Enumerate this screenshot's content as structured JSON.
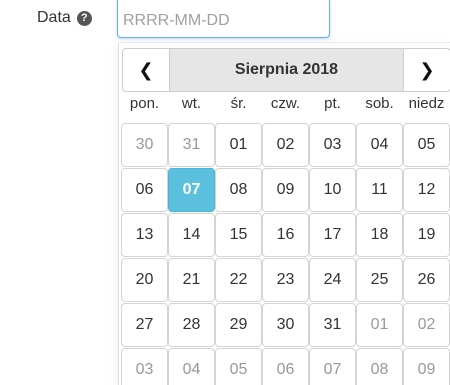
{
  "field": {
    "label": "Data",
    "help_icon": "question-circle-icon",
    "placeholder": "RRRR-MM-DD",
    "value": ""
  },
  "picker": {
    "month_title": "Sierpnia 2018",
    "prev_icon": "chevron-left-icon",
    "next_icon": "chevron-right-icon",
    "prev_glyph": "❮",
    "next_glyph": "❯",
    "weekdays": [
      "pon.",
      "wt.",
      "śr.",
      "czw.",
      "pt.",
      "sob.",
      "niedz"
    ],
    "weeks": [
      [
        {
          "d": "30",
          "m": true
        },
        {
          "d": "31",
          "m": true
        },
        {
          "d": "01"
        },
        {
          "d": "02"
        },
        {
          "d": "03"
        },
        {
          "d": "04"
        },
        {
          "d": "05"
        }
      ],
      [
        {
          "d": "06"
        },
        {
          "d": "07",
          "active": true
        },
        {
          "d": "08"
        },
        {
          "d": "09"
        },
        {
          "d": "10"
        },
        {
          "d": "11"
        },
        {
          "d": "12"
        }
      ],
      [
        {
          "d": "13"
        },
        {
          "d": "14"
        },
        {
          "d": "15"
        },
        {
          "d": "16"
        },
        {
          "d": "17"
        },
        {
          "d": "18"
        },
        {
          "d": "19"
        }
      ],
      [
        {
          "d": "20"
        },
        {
          "d": "21"
        },
        {
          "d": "22"
        },
        {
          "d": "23"
        },
        {
          "d": "24"
        },
        {
          "d": "25"
        },
        {
          "d": "26"
        }
      ],
      [
        {
          "d": "27"
        },
        {
          "d": "28"
        },
        {
          "d": "29"
        },
        {
          "d": "30"
        },
        {
          "d": "31"
        },
        {
          "d": "01",
          "m": true
        },
        {
          "d": "02",
          "m": true
        }
      ],
      [
        {
          "d": "03",
          "m": true
        },
        {
          "d": "04",
          "m": true
        },
        {
          "d": "05",
          "m": true
        },
        {
          "d": "06",
          "m": true
        },
        {
          "d": "07",
          "m": true
        },
        {
          "d": "08",
          "m": true
        },
        {
          "d": "09",
          "m": true
        }
      ]
    ],
    "colors": {
      "active_bg": "#5bc0de",
      "header_bg": "#e6e6e6",
      "muted_text": "#999999"
    }
  }
}
